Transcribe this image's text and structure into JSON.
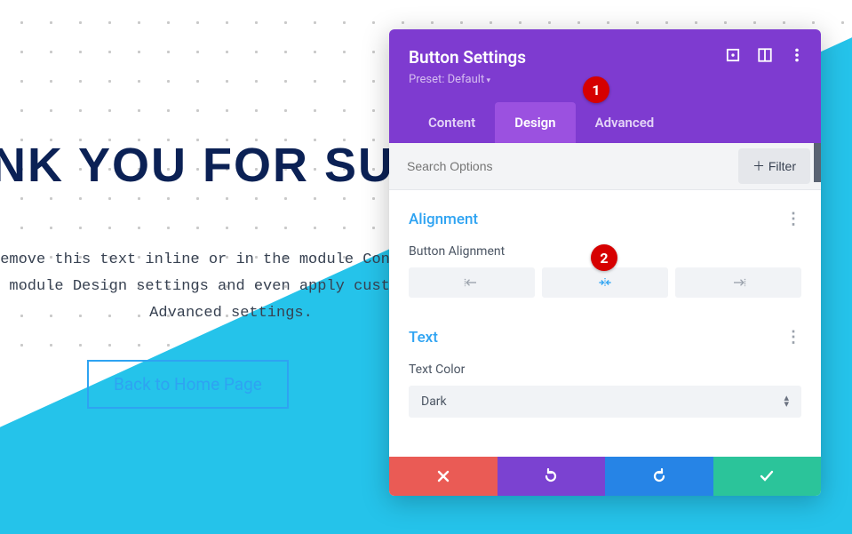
{
  "page": {
    "headline": "NK YOU FOR SUBSCRIB",
    "body_line1": "remove this text inline or in the module Cont",
    "body_line2": "e module Design settings and even apply cust",
    "body_line3": "Advanced settings.",
    "home_button": "Back to Home Page"
  },
  "panel": {
    "title": "Button Settings",
    "preset": "Preset: Default",
    "tabs": {
      "content": "Content",
      "design": "Design",
      "advanced": "Advanced"
    },
    "search_placeholder": "Search Options",
    "filter": "Filter",
    "sections": {
      "alignment": {
        "title": "Alignment",
        "field": "Button Alignment"
      },
      "text": {
        "title": "Text",
        "color_label": "Text Color",
        "color_value": "Dark"
      }
    }
  },
  "annotations": {
    "one": "1",
    "two": "2"
  }
}
